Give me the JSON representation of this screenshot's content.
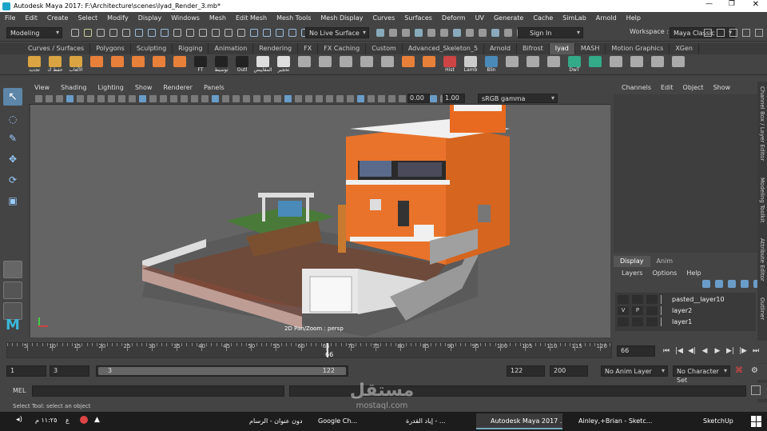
{
  "window": {
    "title": "Autodesk Maya 2017: F:\\Architecture\\scenes\\Iyad_Render_3.mb*"
  },
  "menu": [
    "File",
    "Edit",
    "Create",
    "Select",
    "Modify",
    "Display",
    "Windows",
    "Mesh",
    "Edit Mesh",
    "Mesh Tools",
    "Mesh Display",
    "Curves",
    "Surfaces",
    "Deform",
    "UV",
    "Generate",
    "Cache",
    "SimLab",
    "Arnold",
    "Help"
  ],
  "status": {
    "mode": "Modeling",
    "live_surface": "No Live Surface",
    "sign_in": "Sign In",
    "workspace_label": "Workspace :",
    "workspace": "Maya Classic"
  },
  "shelf_tabs": [
    "Curves / Surfaces",
    "Polygons",
    "Sculpting",
    "Rigging",
    "Animation",
    "Rendering",
    "FX",
    "FX Caching",
    "Custom",
    "Advanced_Skeleton_5",
    "Arnold",
    "Bifrost",
    "Iyad",
    "MASH",
    "Motion Graphics",
    "XGen"
  ],
  "shelf_active": "Iyad",
  "shelf_labels": {
    "tajdid": "تجديد",
    "hifz": "حفظ ك",
    "aleab": "الألعاب",
    "ft": "FT",
    "tawseet": "توسيط",
    "outl": "Outl",
    "maqayees": "المقاييس",
    "tahjeer": "تحجير",
    "hist": "Hist",
    "lamb": "Lamb",
    "blin": "Blin",
    "dwt": "DwT"
  },
  "viewport": {
    "menu": [
      "View",
      "Shading",
      "Lighting",
      "Show",
      "Renderer",
      "Panels"
    ],
    "val1": "0.00",
    "val2": "1.00",
    "colorspace": "sRGB gamma",
    "hud": "2D Pan/Zoom : persp"
  },
  "channel_box": {
    "menu": [
      "Channels",
      "Edit",
      "Object",
      "Show"
    ],
    "side_tab": "Channel Box / Layer Editor"
  },
  "layer_editor": {
    "tabs": [
      "Display",
      "Anim"
    ],
    "menu": [
      "Layers",
      "Options",
      "Help"
    ],
    "layers": [
      {
        "v": "",
        "p": "",
        "name": "pasted__layer10"
      },
      {
        "v": "V",
        "p": "P",
        "name": "layer2"
      },
      {
        "v": "",
        "p": "",
        "name": "layer1"
      }
    ]
  },
  "side_tabs": [
    "Modeling Toolkit",
    "Attribute Editor",
    "Outliner"
  ],
  "timeline": {
    "ticks": [
      "5",
      "10",
      "15",
      "20",
      "25",
      "30",
      "35",
      "40",
      "45",
      "50",
      "55",
      "60",
      "65",
      "70",
      "75",
      "80",
      "85",
      "90",
      "95",
      "100",
      "105",
      "110",
      "115",
      "120"
    ],
    "current": "66",
    "current_field": "66"
  },
  "range": {
    "start": "1",
    "start2": "3",
    "slider_start": "3",
    "slider_end": "122",
    "end1": "122",
    "end2": "200",
    "anim_layer": "No Anim Layer",
    "char_set": "No Character Set"
  },
  "mel": {
    "label": "MEL"
  },
  "help_line": "Select Tool: select an object",
  "taskbar": {
    "time": "١١:٢٥ م",
    "lang": "ع",
    "items": [
      "بدون عنوان - الرسام",
      "Google Ch...",
      "إياد القدرة - ...",
      "Autodesk Maya 2017 ...",
      "Ainley,+Brian - Sketc...",
      "SketchUp"
    ],
    "watermark": "مستقل",
    "watermark_url": "mostaql.com"
  }
}
